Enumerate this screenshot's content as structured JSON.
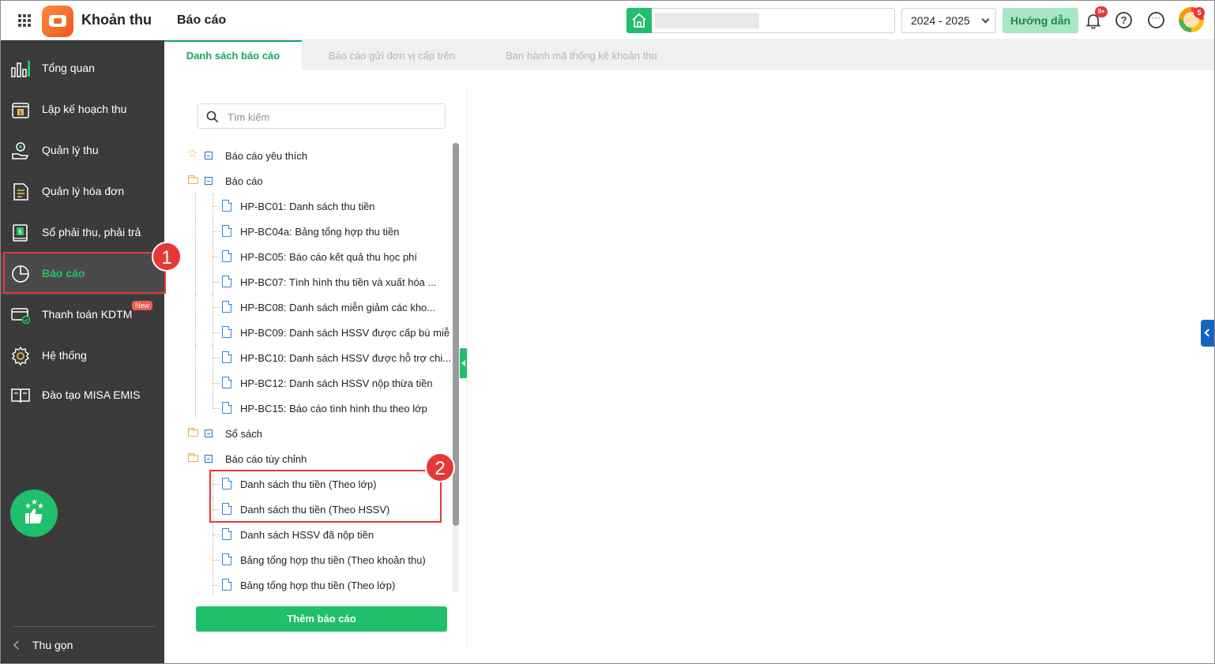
{
  "header": {
    "app_title": "Khoản thu",
    "page_title": "Báo cáo",
    "school_year": "2024 - 2025",
    "guide_label": "Hướng dẫn",
    "notification_count": "9+",
    "avatar_badge": "5",
    "help_glyph": "?",
    "more_glyph": "···"
  },
  "sidebar": {
    "items": [
      {
        "label": "Tổng quan",
        "icon": "chart-bars-icon"
      },
      {
        "label": "Lập kế hoạch thu",
        "icon": "calendar-money-icon"
      },
      {
        "label": "Quản lý thu",
        "icon": "hand-coin-icon"
      },
      {
        "label": "Quản lý hóa đơn",
        "icon": "invoice-icon"
      },
      {
        "label": "Sổ phải thu, phải trả",
        "icon": "ledger-icon"
      },
      {
        "label": "Báo cáo",
        "icon": "pie-chart-icon"
      },
      {
        "label": "Thanh toán KDTM",
        "icon": "card-payment-icon"
      },
      {
        "label": "Hệ thống",
        "icon": "gear-icon"
      },
      {
        "label": "Đào tạo MISA EMIS",
        "icon": "book-icon"
      }
    ],
    "new_badge": "New",
    "collapse_label": "Thu gọn"
  },
  "callouts": {
    "one": "1",
    "two": "2"
  },
  "tabs": [
    {
      "label": "Danh sách báo cáo",
      "active": true
    },
    {
      "label": "Báo cáo gửi đơn vị cấp trên",
      "active": false
    },
    {
      "label": "Ban hành mã thống kê khoản thu",
      "active": false
    }
  ],
  "search": {
    "placeholder": "Tìm kiếm"
  },
  "tree": [
    {
      "label": "Báo cáo yêu thích",
      "kind": "favorite"
    },
    {
      "label": "Báo cáo",
      "kind": "folder"
    },
    {
      "label": "HP-BC01: Danh sách thu tiền",
      "kind": "doc"
    },
    {
      "label": "HP-BC04a: Bảng tổng hợp thu tiền",
      "kind": "doc"
    },
    {
      "label": "HP-BC05: Báo cáo kết quả thu học phí",
      "kind": "doc"
    },
    {
      "label": "HP-BC07: Tình hình thu tiền và xuất hóa ...",
      "kind": "doc"
    },
    {
      "label": "HP-BC08: Danh sách miễn giảm các kho...",
      "kind": "doc"
    },
    {
      "label": "HP-BC09: Danh sách HSSV được cấp bù miễ",
      "kind": "doc"
    },
    {
      "label": "HP-BC10: Danh sách HSSV được hỗ trợ chi...",
      "kind": "doc"
    },
    {
      "label": "HP-BC12: Danh sách HSSV nộp thừa tiền",
      "kind": "doc"
    },
    {
      "label": "HP-BC15: Báo cáo tình hình thu theo lớp",
      "kind": "doc"
    },
    {
      "label": "Sổ sách",
      "kind": "folder"
    },
    {
      "label": "Báo cáo tùy chỉnh",
      "kind": "folder"
    },
    {
      "label": "Danh sách thu tiền (Theo lớp)",
      "kind": "doc2"
    },
    {
      "label": "Danh sách thu tiền (Theo HSSV)",
      "kind": "doc2"
    },
    {
      "label": "Danh sách HSSV đã nộp tiền",
      "kind": "doc2"
    },
    {
      "label": "Bảng tổng hợp thu tiền (Theo khoản thu)",
      "kind": "doc2"
    },
    {
      "label": "Bảng tổng hợp thu tiền (Theo lớp)",
      "kind": "doc2"
    }
  ],
  "add_report_label": "Thêm báo cáo",
  "colors": {
    "brand_green": "#1fbf6b",
    "sidebar_bg": "#3b3b3b",
    "highlight_red": "#e53935"
  }
}
